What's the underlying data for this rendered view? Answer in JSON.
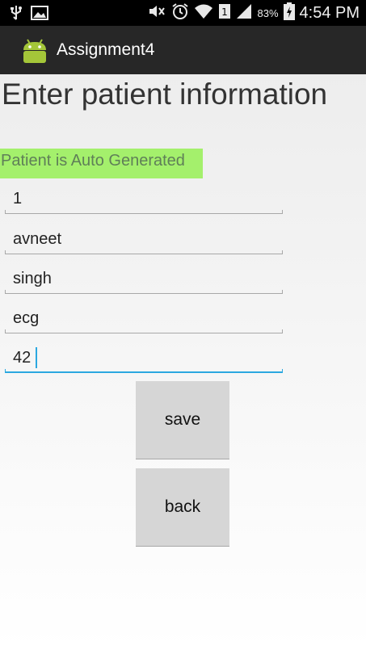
{
  "status_bar": {
    "time": "4:54 PM",
    "battery_percent": "83%",
    "icons": [
      "usb-icon",
      "image-icon",
      "mute-icon",
      "alarm-icon",
      "wifi-icon",
      "sim-icon",
      "signal-icon",
      "battery-charging-icon"
    ]
  },
  "action_bar": {
    "app_title": "Assignment4",
    "icon": "android-icon"
  },
  "form": {
    "heading": "Enter patient information",
    "auto_label": "Patient is Auto Generated",
    "fields": [
      {
        "value": "1"
      },
      {
        "value": "avneet"
      },
      {
        "value": "singh"
      },
      {
        "value": "ecg"
      },
      {
        "value": "42"
      }
    ]
  },
  "buttons": {
    "save_label": "save",
    "back_label": "back"
  },
  "colors": {
    "auto_label_bg": "#a4f06c",
    "focus_accent": "#2ba8e0",
    "action_bar": "#272727"
  }
}
